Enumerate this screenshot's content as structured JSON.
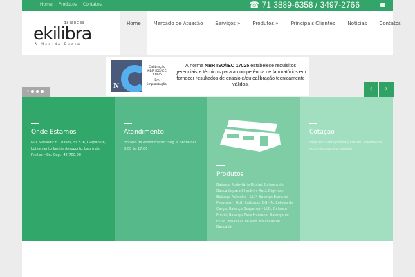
{
  "topbar": {
    "links": [
      "Home",
      "Produtos",
      "Contatos"
    ],
    "phone": "☎ 71 3889-6358 / 3497-2766"
  },
  "logo": {
    "word": "ekilibra",
    "sub": "Balanças",
    "tagline": "A Medida Exata"
  },
  "nav": [
    "Home",
    "Mercado de Atuação",
    "Serviços »",
    "Produtos »",
    "Principais Clientes",
    "Notícias",
    "Contatos"
  ],
  "banner": {
    "caption": [
      "Calibração",
      "NBR ISO/IEC",
      "17025",
      "Em implantação"
    ],
    "text_pre": "A norma ",
    "text_bold": "NBR ISO/IEC 17025",
    "text_post": " estabelece requisitos gerenciais e técnicos para a competência de laboratórios em fornecer resultados de ensaio e/ou calibração tecnicamente válidos."
  },
  "slider": {
    "prev": "‹",
    "next": "›"
  },
  "columns": [
    {
      "title": "Onde Estamos",
      "text": "Rua Silvandir F. Chaves, nº 526, Galpão 06, Loteamento Jardim Aeroporto, Lauro de Freitas – Ba. Cep.: 42.700.00",
      "color": "#31a86a"
    },
    {
      "title": "Atendimento",
      "text": "Horário de Atendimento: Seg. à Sexta das 8:00 às 17:00",
      "color": "#56b98a"
    },
    {
      "title": "Produtos",
      "text": "Balança Rodoviária Digital, Balança de Bancada para Check-in, Rack Digi-tron, Balança Paleteira - ULP, Balança Barra de Pesagem - ULB, Indicador DG - N, Células de Carga, Balança Suspensa - ULD, Balança Móvel, Balança Peso Humano, Balança de Fluxo, Balanças de Piso, Balanças de Bancada",
      "color": "#7ecda5"
    },
    {
      "title": "Cotação",
      "text": "Faça aqui uma prévia para seu orçamento, aguardamos seu contato",
      "color": "#a1dfc0"
    }
  ]
}
